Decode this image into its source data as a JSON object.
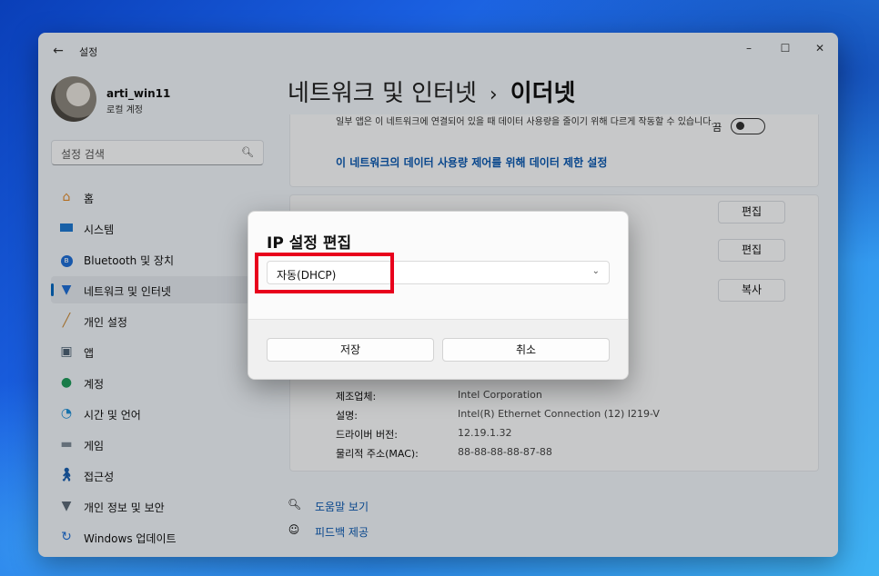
{
  "window": {
    "app_title": "설정",
    "back_glyph": "←",
    "minimize_glyph": "–",
    "maximize_glyph": "☐",
    "close_glyph": "✕"
  },
  "user": {
    "name": "arti_win11",
    "account_type": "로컬 계정"
  },
  "search": {
    "placeholder": "설정 검색"
  },
  "sidebar": {
    "items": [
      {
        "label": "홈",
        "icon": "home-icon"
      },
      {
        "label": "시스템",
        "icon": "system-icon"
      },
      {
        "label": "Bluetooth 및 장치",
        "icon": "bluetooth-icon"
      },
      {
        "label": "네트워크 및 인터넷",
        "icon": "wifi-icon",
        "active": true
      },
      {
        "label": "개인 설정",
        "icon": "brush-icon"
      },
      {
        "label": "앱",
        "icon": "apps-icon"
      },
      {
        "label": "계정",
        "icon": "account-icon"
      },
      {
        "label": "시간 및 언어",
        "icon": "globe-icon"
      },
      {
        "label": "게임",
        "icon": "gamepad-icon"
      },
      {
        "label": "접근성",
        "icon": "accessibility-icon"
      },
      {
        "label": "개인 정보 및 보안",
        "icon": "shield-icon"
      },
      {
        "label": "Windows 업데이트",
        "icon": "update-icon"
      }
    ]
  },
  "breadcrumb": {
    "parent": "네트워크 및 인터넷",
    "separator": "›",
    "current": "이더넷"
  },
  "data_usage": {
    "description": "일부 앱은 이 네트워크에 연결되어 있을 때 데이터 사용량을 줄이기 위해 다르게 작동할 수 있습니다.",
    "toggle_label": "끔",
    "link": "이 네트워크의 데이터 사용량 제어를 위해 데이터 제한 설정"
  },
  "actions": {
    "edit1": "편집",
    "edit2": "편집",
    "copy": "복사"
  },
  "properties": [
    {
      "label": "제조업체:",
      "value": "Intel Corporation"
    },
    {
      "label": "설명:",
      "value": "Intel(R) Ethernet Connection (12) I219-V"
    },
    {
      "label": "드라이버 버전:",
      "value": "12.19.1.32"
    },
    {
      "label": "물리적 주소(MAC):",
      "value": "88-88-88-88-87-88"
    }
  ],
  "help": {
    "get_help": "도움말 보기",
    "feedback": "피드백 제공"
  },
  "dialog": {
    "title": "IP 설정 편집",
    "selected": "자동(DHCP)",
    "save": "저장",
    "cancel": "취소"
  },
  "colors": {
    "accent": "#0067c0",
    "highlight": "#e8001c",
    "link": "#0a58b0"
  }
}
